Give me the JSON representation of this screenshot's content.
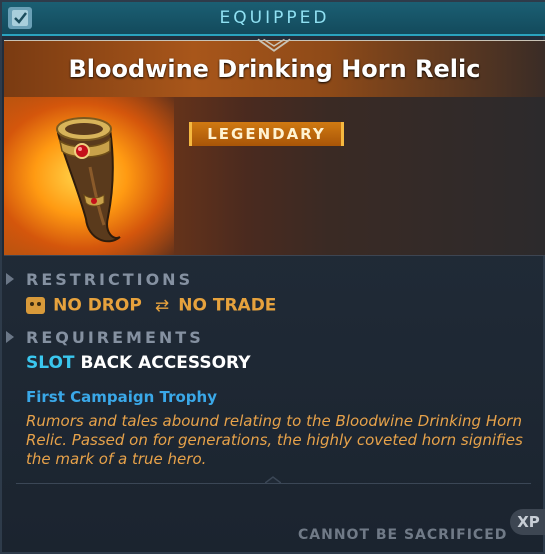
{
  "header": {
    "status_label": "EQUIPPED"
  },
  "item": {
    "name": "Bloodwine Drinking Horn Relic",
    "rarity": "LEGENDARY",
    "rarity_color": "#c8700e",
    "icon": "drinking-horn-icon"
  },
  "restrictions": {
    "heading": "RESTRICTIONS",
    "no_drop": "NO DROP",
    "no_trade": "NO TRADE",
    "no_drop_icon": "skull-icon",
    "no_trade_icon": "trade-arrows-icon"
  },
  "requirements": {
    "heading": "REQUIREMENTS",
    "slot_label": "SLOT",
    "slot_value": "BACK ACCESSORY"
  },
  "source": "First Campaign Trophy",
  "description": "Rumors and tales abound relating to the Bloodwine Drinking Horn Relic. Passed on for generations, the highly coveted horn signifies the mark of a true hero.",
  "footer": {
    "sacrifice_status": "CANNOT BE SACRIFICED",
    "xp_label": "XP"
  },
  "colors": {
    "accent_cyan": "#3ac7ef",
    "legendary_orange": "#e6a23d",
    "source_blue": "#3aa8e8"
  }
}
